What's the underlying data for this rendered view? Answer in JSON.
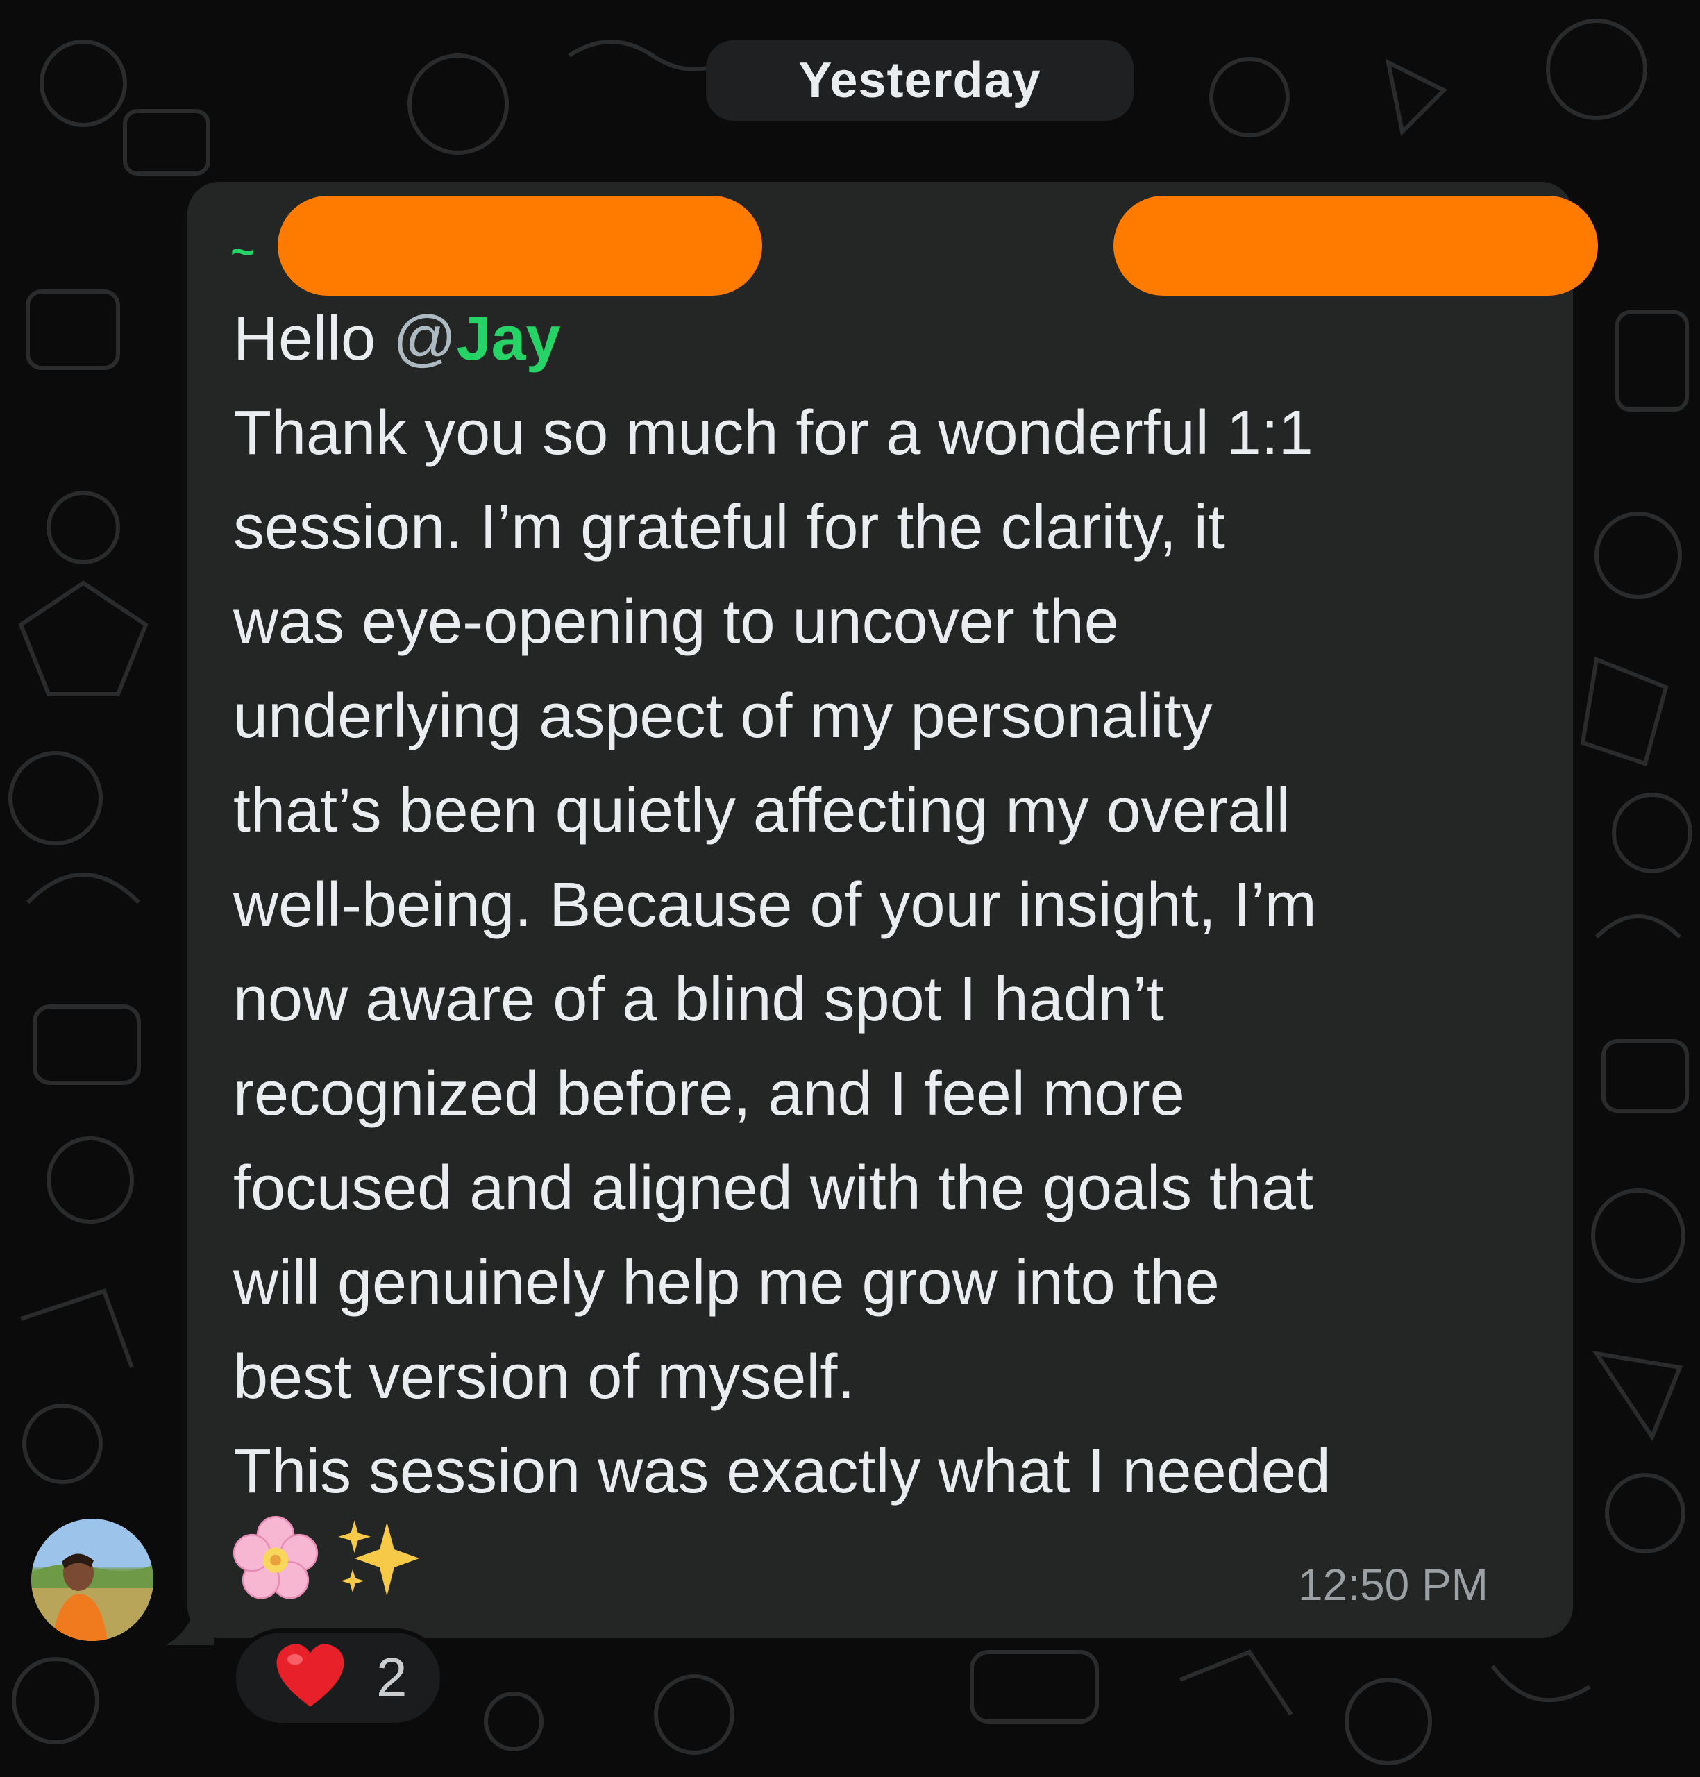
{
  "date_divider": "Yesterday",
  "message": {
    "sender_prefix": "~",
    "greeting": "Hello ",
    "mention_at": "@",
    "mention_name": "Jay",
    "lines": [
      "Thank you so much for a wonderful 1:1",
      "session. I’m grateful for the clarity, it",
      "was eye-opening to uncover the",
      "underlying aspect of my personality",
      "that’s been quietly affecting my overall",
      "well-being. Because of your insight, I’m",
      "now aware of a blind spot I hadn’t",
      "recognized before, and I feel more",
      "focused and aligned with the goals that",
      "will genuinely help me grow into the",
      "best version of myself.",
      "This session was exactly what I needed"
    ],
    "emojis": [
      "cherry-blossom",
      "sparkles"
    ],
    "time": "12:50 PM"
  },
  "reaction": {
    "emoji": "red-heart",
    "count": "2"
  },
  "colors": {
    "background": "#0b0b0b",
    "bubble": "#242626",
    "mention": "#25d366",
    "redaction": "#ff7b00",
    "text": "#e9edef",
    "timestamp": "#9aa0a3"
  }
}
